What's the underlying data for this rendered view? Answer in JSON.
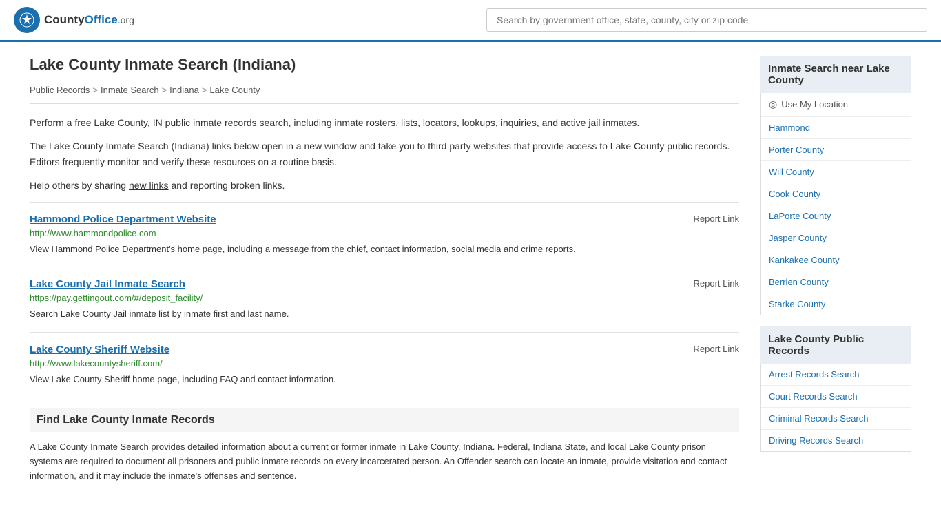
{
  "header": {
    "logo_text": "County",
    "logo_brand": "County",
    "logo_org": "Office.org",
    "search_placeholder": "Search by government office, state, county, city or zip code"
  },
  "page": {
    "title": "Lake County Inmate Search (Indiana)",
    "breadcrumb": [
      {
        "label": "Public Records",
        "href": "#"
      },
      {
        "label": "Inmate Search",
        "href": "#"
      },
      {
        "label": "Indiana",
        "href": "#"
      },
      {
        "label": "Lake County",
        "href": "#"
      }
    ],
    "description1": "Perform a free Lake County, IN public inmate records search, including inmate rosters, lists, locators, lookups, inquiries, and active jail inmates.",
    "description2": "The Lake County Inmate Search (Indiana) links below open in a new window and take you to third party websites that provide access to Lake County public records. Editors frequently monitor and verify these resources on a routine basis.",
    "description3_pre": "Help others by sharing ",
    "description3_link": "new links",
    "description3_post": " and reporting broken links.",
    "results": [
      {
        "title": "Hammond Police Department Website",
        "url": "http://www.hammondpolice.com",
        "description": "View Hammond Police Department's home page, including a message from the chief, contact information, social media and crime reports."
      },
      {
        "title": "Lake County Jail Inmate Search",
        "url": "https://pay.gettingout.com/#/deposit_facility/",
        "description": "Search Lake County Jail inmate list by inmate first and last name."
      },
      {
        "title": "Lake County Sheriff Website",
        "url": "http://www.lakecountysheriff.com/",
        "description": "View Lake County Sheriff home page, including FAQ and contact information."
      }
    ],
    "report_link_label": "Report Link",
    "find_section": {
      "title": "Find Lake County Inmate Records",
      "description": "A Lake County Inmate Search provides detailed information about a current or former inmate in Lake County, Indiana. Federal, Indiana State, and local Lake County prison systems are required to document all prisoners and public inmate records on every incarcerated person. An Offender search can locate an inmate, provide visitation and contact information, and it may include the inmate's offenses and sentence."
    }
  },
  "sidebar": {
    "inmate_search_section": {
      "title": "Inmate Search near Lake County",
      "use_location": "Use My Location",
      "links": [
        {
          "label": "Hammond",
          "href": "#"
        },
        {
          "label": "Porter County",
          "href": "#"
        },
        {
          "label": "Will County",
          "href": "#"
        },
        {
          "label": "Cook County",
          "href": "#"
        },
        {
          "label": "LaPorte County",
          "href": "#"
        },
        {
          "label": "Jasper County",
          "href": "#"
        },
        {
          "label": "Kankakee County",
          "href": "#"
        },
        {
          "label": "Berrien County",
          "href": "#"
        },
        {
          "label": "Starke County",
          "href": "#"
        }
      ]
    },
    "public_records_section": {
      "title": "Lake County Public Records",
      "links": [
        {
          "label": "Arrest Records Search",
          "href": "#"
        },
        {
          "label": "Court Records Search",
          "href": "#"
        },
        {
          "label": "Criminal Records Search",
          "href": "#"
        },
        {
          "label": "Driving Records Search",
          "href": "#"
        }
      ]
    }
  }
}
